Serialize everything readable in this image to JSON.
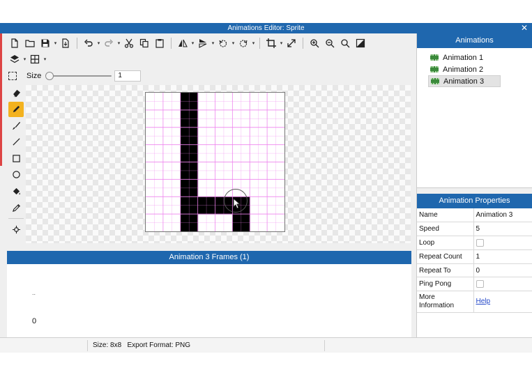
{
  "window": {
    "title": "Animations Editor: Sprite",
    "close_label": "✕"
  },
  "toolbar": {
    "size_label": "Size",
    "size_value": "1",
    "size_slider_fraction": 0.0
  },
  "canvas": {
    "grid_size": 8,
    "filled_pixels": [
      [
        2,
        0
      ],
      [
        2,
        1
      ],
      [
        2,
        2
      ],
      [
        2,
        3
      ],
      [
        2,
        4
      ],
      [
        2,
        5
      ],
      [
        2,
        6
      ],
      [
        2,
        7
      ],
      [
        3,
        6
      ],
      [
        4,
        6
      ],
      [
        5,
        6
      ],
      [
        5,
        7
      ]
    ],
    "pixel_color": "#000000",
    "grid_color": "#ee82ee"
  },
  "frames": {
    "header": "Animation 3 Frames (1)",
    "dots": "..",
    "index": "0"
  },
  "animations": {
    "header": "Animations",
    "items": [
      {
        "label": "Animation 1",
        "selected": false
      },
      {
        "label": "Animation 2",
        "selected": false
      },
      {
        "label": "Animation 3",
        "selected": true
      }
    ]
  },
  "properties": {
    "header": "Animation Properties",
    "rows": {
      "name": {
        "key": "Name",
        "value": "Animation 3"
      },
      "speed": {
        "key": "Speed",
        "value": "5"
      },
      "loop": {
        "key": "Loop",
        "checked": false
      },
      "repeat_count": {
        "key": "Repeat Count",
        "value": "1"
      },
      "repeat_to": {
        "key": "Repeat To",
        "value": "0"
      },
      "ping_pong": {
        "key": "Ping Pong",
        "checked": false
      },
      "more_info": {
        "key_line1": "More",
        "key_line2": "Information",
        "value": "Help"
      }
    }
  },
  "statusbar": {
    "text": "Size: 8x8   Export Format: PNG"
  },
  "colors": {
    "accent": "#1f67ae",
    "active_tool": "#f3b21f",
    "link": "#2448c8"
  }
}
